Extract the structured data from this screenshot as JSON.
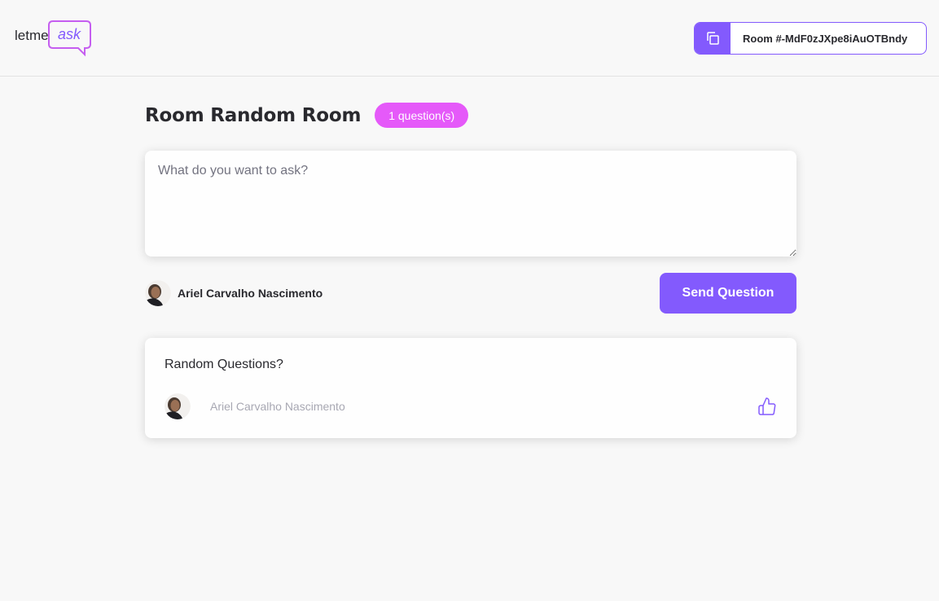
{
  "header": {
    "logo": {
      "text_main": "letme",
      "text_accent": "ask"
    },
    "room_code": {
      "label": "Room #-MdF0zJXpe8iAuOTBndy"
    }
  },
  "room": {
    "title": "Room Random Room",
    "question_count": "1 question(s)"
  },
  "ask_form": {
    "placeholder": "What do you want to ask?",
    "value": "",
    "user_name": "Ariel Carvalho Nascimento",
    "send_label": "Send Question"
  },
  "questions": [
    {
      "content": "Random Questions?",
      "author": "Ariel Carvalho Nascimento"
    }
  ],
  "colors": {
    "accent": "#835afd",
    "badge": "#e559f9",
    "text": "#29292e",
    "muted": "#a8a8b3"
  },
  "icons": [
    "copy-icon",
    "like-icon",
    "avatar"
  ]
}
